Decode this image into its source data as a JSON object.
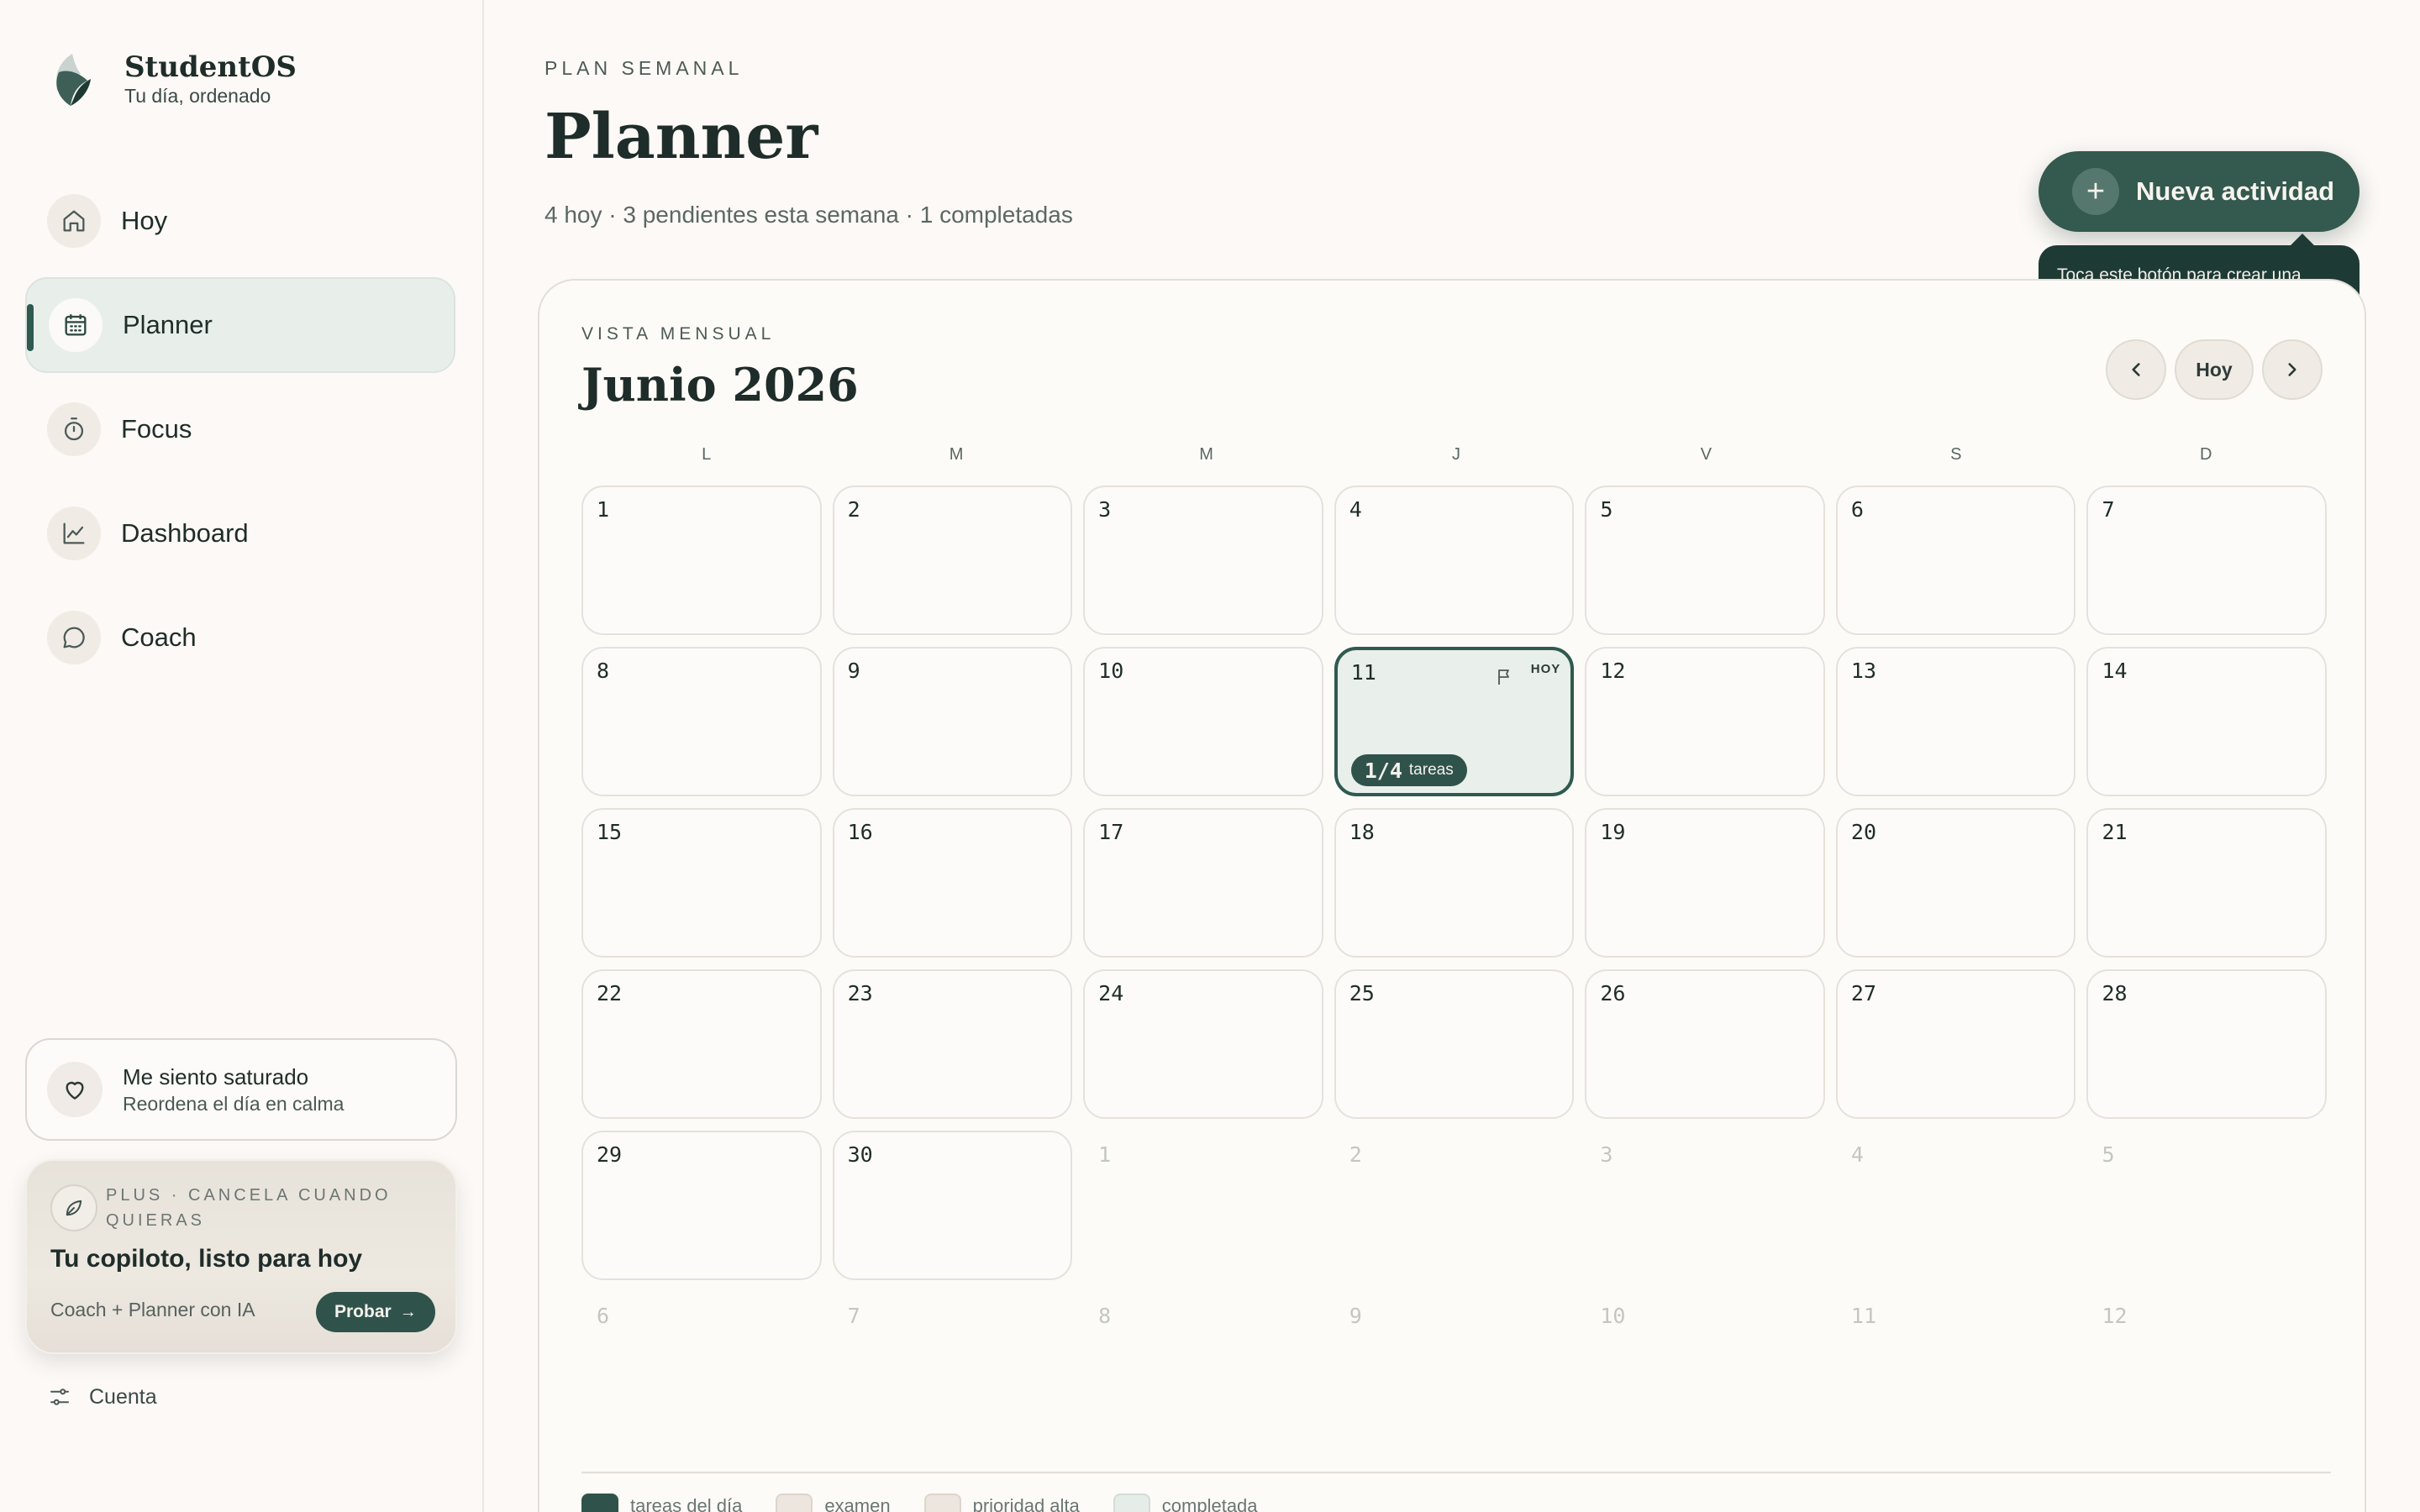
{
  "brand": {
    "name": "StudentOS",
    "tagline": "Tu día, ordenado"
  },
  "nav": [
    {
      "label": "Hoy",
      "icon": "home-icon",
      "active": false
    },
    {
      "label": "Planner",
      "icon": "calendar-icon",
      "active": true
    },
    {
      "label": "Focus",
      "icon": "timer-icon",
      "active": false
    },
    {
      "label": "Dashboard",
      "icon": "chart-icon",
      "active": false
    },
    {
      "label": "Coach",
      "icon": "chat-icon",
      "active": false
    }
  ],
  "mood": {
    "title": "Me siento saturado",
    "subtitle": "Reordena el día en calma",
    "icon": "heart-icon"
  },
  "plus": {
    "kicker": "PLUS · CANCELA CUANDO QUIERAS",
    "title": "Tu copiloto, listo para hoy",
    "desc": "Coach + Planner con IA",
    "cta": "Probar",
    "icon": "leaf-icon"
  },
  "account": {
    "label": "Cuenta",
    "icon": "sliders-icon"
  },
  "header": {
    "kicker": "PLAN SEMANAL",
    "title": "Planner",
    "subtitle": "4 hoy · 3 pendientes esta semana · 1 completadas"
  },
  "new_activity": {
    "label": "Nueva actividad",
    "tooltip": "Toca este botón para crear una nueva tarea o actividad."
  },
  "calendar": {
    "kicker": "VISTA MENSUAL",
    "title": "Junio 2026",
    "nav": {
      "prev": "‹",
      "today": "Hoy",
      "next": "›"
    },
    "weekdays": [
      "L",
      "M",
      "M",
      "J",
      "V",
      "S",
      "D"
    ],
    "today": {
      "day": "11",
      "badge": "HOY",
      "count": "1/4",
      "unit": "tareas"
    },
    "weeks": [
      [
        [
          "1",
          false
        ],
        [
          "2",
          false
        ],
        [
          "3",
          false
        ],
        [
          "4",
          false
        ],
        [
          "5",
          false
        ],
        [
          "6",
          false
        ],
        [
          "7",
          false
        ]
      ],
      [
        [
          "8",
          false
        ],
        [
          "9",
          false
        ],
        [
          "10",
          false
        ],
        [
          "11",
          false
        ],
        [
          "12",
          false
        ],
        [
          "13",
          false
        ],
        [
          "14",
          false
        ]
      ],
      [
        [
          "15",
          false
        ],
        [
          "16",
          false
        ],
        [
          "17",
          false
        ],
        [
          "18",
          false
        ],
        [
          "19",
          false
        ],
        [
          "20",
          false
        ],
        [
          "21",
          false
        ]
      ],
      [
        [
          "22",
          false
        ],
        [
          "23",
          false
        ],
        [
          "24",
          false
        ],
        [
          "25",
          false
        ],
        [
          "26",
          false
        ],
        [
          "27",
          false
        ],
        [
          "28",
          false
        ]
      ],
      [
        [
          "29",
          false
        ],
        [
          "30",
          false
        ],
        [
          "1",
          true
        ],
        [
          "2",
          true
        ],
        [
          "3",
          true
        ],
        [
          "4",
          true
        ],
        [
          "5",
          true
        ]
      ],
      [
        [
          "6",
          true
        ],
        [
          "7",
          true
        ],
        [
          "8",
          true
        ],
        [
          "9",
          true
        ],
        [
          "10",
          true
        ],
        [
          "11",
          true
        ],
        [
          "12",
          true
        ]
      ]
    ],
    "legend": [
      "tareas del día",
      "examen",
      "prioridad alta",
      "completada"
    ]
  },
  "colors": {
    "accent": "#2f534b",
    "background": "#fcf9f6",
    "text": "#1f2d2a"
  }
}
